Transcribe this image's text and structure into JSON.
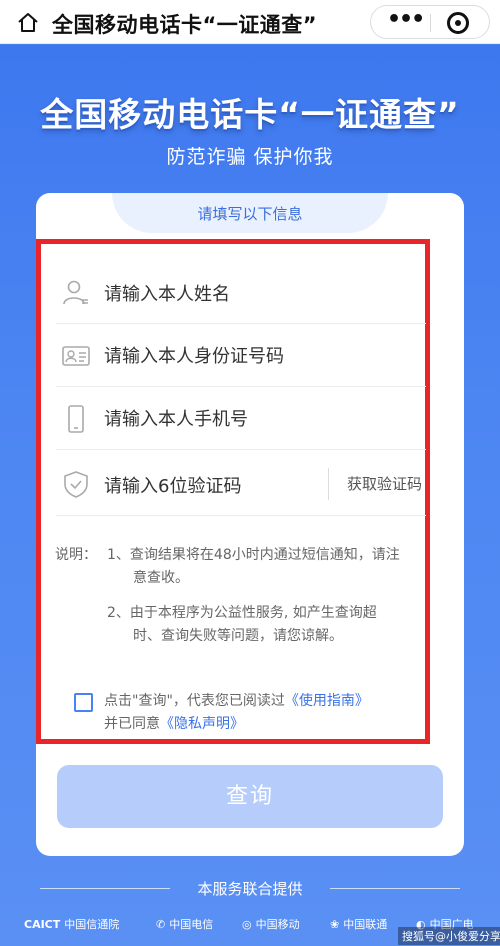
{
  "window": {
    "title": "全国移动电话卡“一证通查”",
    "more_glyph": "•••"
  },
  "hero": {
    "title": "全国移动电话卡“一证通查”",
    "subtitle": "防范诈骗 保护你我"
  },
  "card": {
    "tab_label": "请填写以下信息"
  },
  "form": {
    "name_placeholder": "请输入本人姓名",
    "id_placeholder": "请输入本人身份证号码",
    "phone_placeholder": "请输入本人手机号",
    "code_placeholder": "请输入6位验证码",
    "get_code_label": "获取验证码"
  },
  "notes": {
    "label": "说明：",
    "items": [
      {
        "line1": "1、查询结果将在48小时内通过短信通知，请注",
        "line2": "意查收。"
      },
      {
        "line1": "2、由于本程序为公益性服务, 如产生查询超",
        "line2": "时、查询失败等问题，请您谅解。"
      }
    ]
  },
  "agreement": {
    "text_before": "点击\"查询\"，代表您已阅读过",
    "guide_link": "《使用指南》",
    "text_middle": "并已同意",
    "privacy_link": "《隐私声明》",
    "checked": false
  },
  "query_button": "查询",
  "provider": {
    "label": "本服务联合提供",
    "logos": [
      {
        "mark": "CAICT",
        "name": "中国信通院"
      },
      {
        "mark": "✆",
        "name": "中国电信"
      },
      {
        "mark": "◎",
        "name": "中国移动"
      },
      {
        "mark": "❀",
        "name": "中国联通"
      },
      {
        "mark": "◐",
        "name": "中国广电"
      }
    ]
  },
  "watermark": "搜狐号@小俊爱分享",
  "colors": {
    "brand_blue": "#4a83f0",
    "highlight_red": "#e8262a",
    "button_disabled": "#b6cdfb",
    "link": "#3a72e8"
  }
}
